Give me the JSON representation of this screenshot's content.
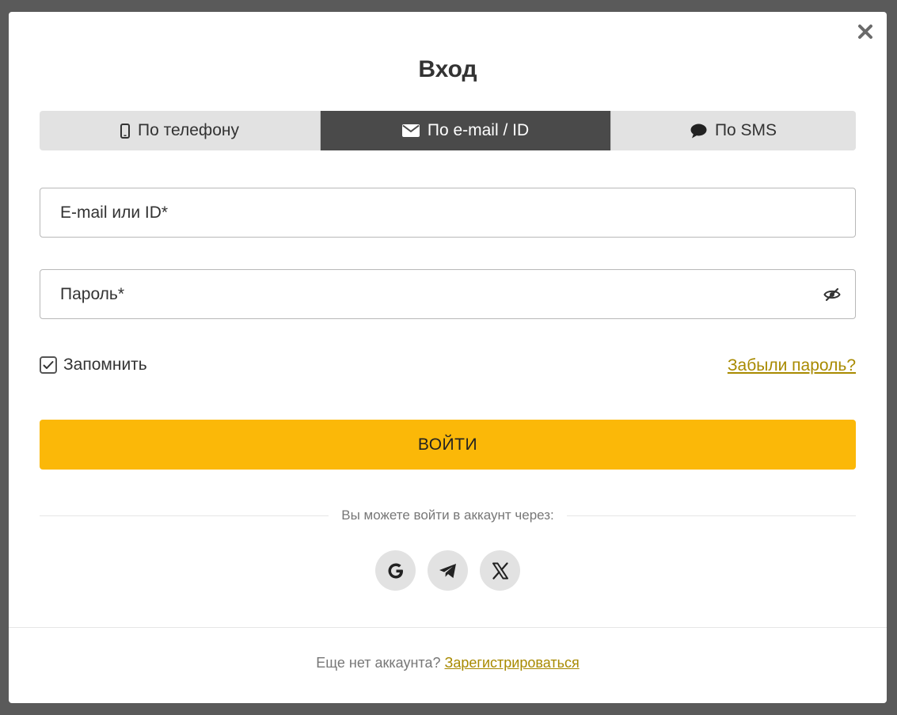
{
  "modal": {
    "title": "Вход",
    "close_icon": "close-icon"
  },
  "tabs": [
    {
      "label": "По телефону",
      "icon": "mobile-phone-icon",
      "active": false
    },
    {
      "label": "По e-mail / ID",
      "icon": "envelope-icon",
      "active": true
    },
    {
      "label": "По SMS",
      "icon": "speech-bubble-icon",
      "active": false
    }
  ],
  "form": {
    "email_placeholder": "E-mail или ID*",
    "email_value": "",
    "password_placeholder": "Пароль*",
    "password_value": "",
    "password_toggle_icon": "eye-slash-icon",
    "remember_label": "Запомнить",
    "remember_checked": true,
    "forgot_label": "Забыли пароль?",
    "submit_label": "ВОЙТИ"
  },
  "social": {
    "divider_text": "Вы можете войти в аккаунт через:",
    "providers": [
      {
        "name": "google",
        "icon": "google-icon"
      },
      {
        "name": "telegram",
        "icon": "telegram-icon"
      },
      {
        "name": "x",
        "icon": "x-icon"
      }
    ]
  },
  "footer": {
    "text": "Еще нет аккаунта?",
    "register_label": "Зарегистрироваться"
  },
  "colors": {
    "accent": "#fbb808",
    "link": "#a88a00",
    "tab_active": "#4a4a4a",
    "tab_inactive": "#e2e2e2"
  }
}
